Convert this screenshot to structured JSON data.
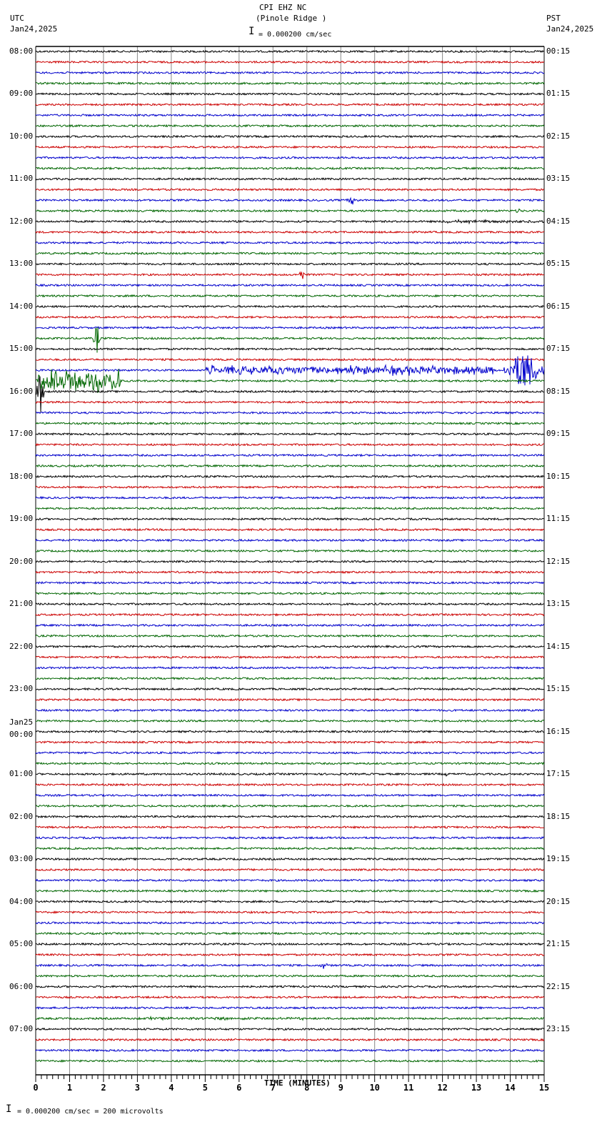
{
  "header": {
    "title": "CPI EHZ NC",
    "subtitle": "(Pinole Ridge )",
    "left_tz": "UTC",
    "left_date": "Jan24,2025",
    "right_tz": "PST",
    "right_date": "Jan24,2025",
    "scale_text": "= 0.000200 cm/sec"
  },
  "footer": {
    "scale_text": "= 0.000200 cm/sec =     200 microvolts"
  },
  "chart_data": {
    "type": "line",
    "title": "CPI EHZ NC (Pinole Ridge )",
    "xlabel": "TIME (MINUTES)",
    "xlim": [
      0,
      15
    ],
    "x_ticks": [
      "0",
      "1",
      "2",
      "3",
      "4",
      "5",
      "6",
      "7",
      "8",
      "9",
      "10",
      "11",
      "12",
      "13",
      "14",
      "15"
    ],
    "minutes_per_trace": 15,
    "trace_colors": [
      "#000000",
      "#cc0000",
      "#0000cc",
      "#006600"
    ],
    "trace_count": 96,
    "left_labels": [
      "08:00",
      "09:00",
      "10:00",
      "11:00",
      "12:00",
      "13:00",
      "14:00",
      "15:00",
      "16:00",
      "17:00",
      "18:00",
      "19:00",
      "20:00",
      "21:00",
      "22:00",
      "23:00",
      "00:00",
      "01:00",
      "02:00",
      "03:00",
      "04:00",
      "05:00",
      "06:00",
      "07:00"
    ],
    "left_date_change": {
      "hour_index": 16,
      "label": "Jan25"
    },
    "right_labels": [
      "00:15",
      "01:15",
      "02:15",
      "03:15",
      "04:15",
      "05:15",
      "06:15",
      "07:15",
      "08:15",
      "09:15",
      "10:15",
      "11:15",
      "12:15",
      "13:15",
      "14:15",
      "15:15",
      "16:15",
      "17:15",
      "18:15",
      "19:15",
      "20:15",
      "21:15",
      "22:15",
      "23:15"
    ],
    "events": [
      {
        "trace": 14,
        "start_min": 9.1,
        "end_min": 9.6,
        "amplitude": 6
      },
      {
        "trace": 15,
        "start_min": 14.1,
        "end_min": 14.4,
        "amplitude": 4
      },
      {
        "trace": 16,
        "start_min": 12.0,
        "end_min": 15.0,
        "amplitude": 3
      },
      {
        "trace": 21,
        "start_min": 7.75,
        "end_min": 7.95,
        "amplitude": 10
      },
      {
        "trace": 27,
        "start_min": 1.7,
        "end_min": 1.9,
        "amplitude": 25
      },
      {
        "trace": 30,
        "start_min": 5.0,
        "end_min": 13.5,
        "amplitude": 9
      },
      {
        "trace": 30,
        "start_min": 13.8,
        "end_min": 15.0,
        "amplitude": 30
      },
      {
        "trace": 31,
        "start_min": 0.0,
        "end_min": 2.5,
        "amplitude": 22
      },
      {
        "trace": 32,
        "start_min": 0.0,
        "end_min": 0.3,
        "amplitude": 30
      },
      {
        "trace": 68,
        "start_min": 12.0,
        "end_min": 12.2,
        "amplitude": 4
      },
      {
        "trace": 86,
        "start_min": 8.35,
        "end_min": 8.65,
        "amplitude": 6
      },
      {
        "trace": 91,
        "start_min": 3.0,
        "end_min": 8.0,
        "amplitude": 3
      }
    ]
  }
}
